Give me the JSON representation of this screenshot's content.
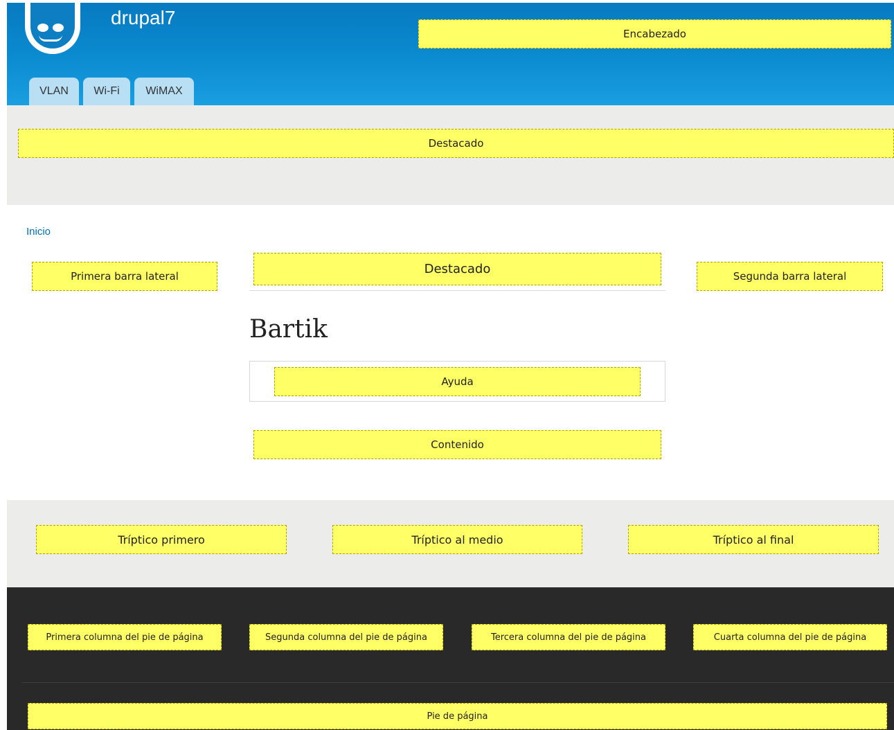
{
  "header": {
    "site_name": "drupal7",
    "region_label": "Encabezado",
    "tabs": [
      {
        "label": "VLAN"
      },
      {
        "label": "Wi-Fi"
      },
      {
        "label": "WiMAX"
      }
    ]
  },
  "featured": {
    "label": "Destacado"
  },
  "breadcrumb": {
    "label": "Inicio"
  },
  "sidebars": {
    "first": "Primera barra lateral",
    "second": "Segunda barra lateral"
  },
  "main": {
    "highlighted": "Destacado",
    "title": "Bartik",
    "help": "Ayuda",
    "content": "Contenido"
  },
  "triptych": {
    "first": "Tríptico primero",
    "middle": "Tríptico al medio",
    "last": "Tríptico al final"
  },
  "footer": {
    "columns": [
      "Primera columna del pie de página",
      "Segunda columna del pie de página",
      "Tercera columna del pie de página",
      "Cuarta columna del pie de página"
    ],
    "footer_label": "Pie de página"
  },
  "colors": {
    "header_blue": "#0b8bd0",
    "tab_bg": "#b9dff5",
    "region_yellow": "#ffff66",
    "band_grey": "#ecedea",
    "footer_dark": "#292929",
    "link_blue": "#0071b3"
  }
}
